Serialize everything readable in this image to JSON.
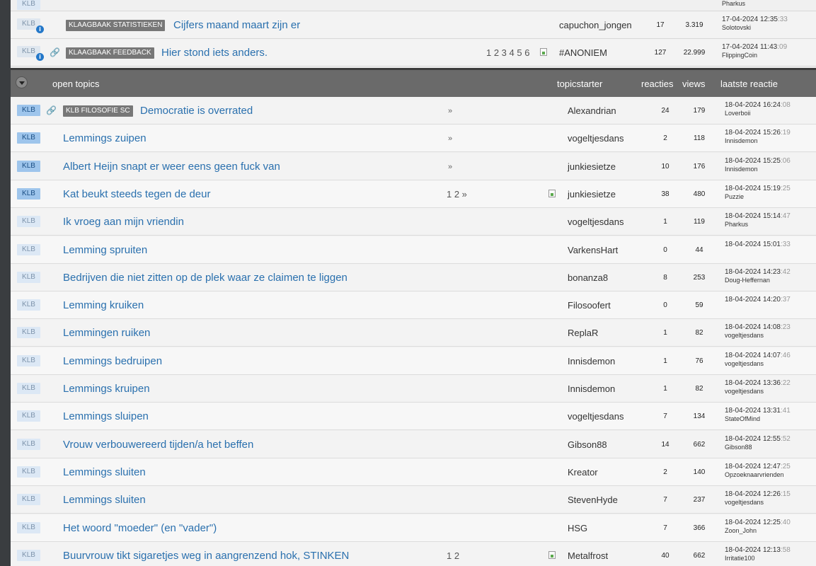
{
  "partial_row": {
    "user": "Pharkus"
  },
  "pinned": [
    {
      "badge": "KLB",
      "tag": "KLAAGBAAK STATISTIEKEN",
      "title": "Cijfers maand maart zijn er",
      "pages": "",
      "starter": "capuchon_jongen",
      "reacties": "17",
      "views": "3.319",
      "date": "17-04-2024",
      "time": "12:35",
      "sec": ":33",
      "last_user": "Solotovski"
    },
    {
      "badge": "KLB",
      "tag": "KLAAGBAAK FEEDBACK",
      "title": "Hier stond iets anders.",
      "pages": "1 2 3 4 5 6",
      "starter": "#ANONIEM",
      "reacties": "127",
      "views": "22.999",
      "date": "17-04-2024",
      "time": "11:43",
      "sec": ":09",
      "last_user": "FlippingCoin"
    }
  ],
  "header": {
    "open_topics": "open topics",
    "topicstarter": "topicstarter",
    "reacties": "reacties",
    "views": "views",
    "laatste_reactie": "laatste reactie"
  },
  "topics": [
    {
      "badge": "KLB",
      "tag": "KLB FILOSOFIE SC",
      "title": "Democratie is overrated",
      "pages": "",
      "arrow": "»",
      "starter": "Alexandrian",
      "reacties": "24",
      "views": "179",
      "date": "18-04-2024",
      "time": "16:24",
      "sec": ":08",
      "last_user": "Loverboii"
    },
    {
      "badge": "KLB",
      "title": "Lemmings zuipen",
      "pages": "",
      "arrow": "»",
      "starter": "vogeltjesdans",
      "reacties": "2",
      "views": "118",
      "date": "18-04-2024",
      "time": "15:26",
      "sec": ":19",
      "last_user": "Innisdemon"
    },
    {
      "badge": "KLB",
      "title": "Albert Heijn snapt er weer eens geen fuck van",
      "pages": "",
      "arrow": "»",
      "starter": "junkiesietze",
      "reacties": "10",
      "views": "176",
      "date": "18-04-2024",
      "time": "15:25",
      "sec": ":06",
      "last_user": "Innisdemon"
    },
    {
      "badge": "KLB",
      "title": "Kat beukt steeds tegen de deur",
      "pages": "1 2 »",
      "arrow": "",
      "starter": "junkiesietze",
      "reacties": "38",
      "views": "480",
      "date": "18-04-2024",
      "time": "15:19",
      "sec": ":25",
      "last_user": "Puzzie"
    },
    {
      "badge": "KLB",
      "title": "Ik vroeg aan mijn vriendin",
      "pages": "",
      "arrow": "",
      "starter": "vogeltjesdans",
      "reacties": "1",
      "views": "119",
      "date": "18-04-2024",
      "time": "15:14",
      "sec": ":47",
      "last_user": "Pharkus"
    },
    {
      "badge": "KLB",
      "title": "Lemming spruiten",
      "pages": "",
      "arrow": "",
      "starter": "VarkensHart",
      "reacties": "0",
      "views": "44",
      "date": "18-04-2024",
      "time": "15:01",
      "sec": ":33",
      "last_user": ""
    },
    {
      "badge": "KLB",
      "title": "Bedrijven die niet zitten op de plek waar ze claimen te liggen",
      "pages": "",
      "arrow": "",
      "starter": "bonanza8",
      "reacties": "8",
      "views": "253",
      "date": "18-04-2024",
      "time": "14:23",
      "sec": ":42",
      "last_user": "Doug-Heffernan"
    },
    {
      "badge": "KLB",
      "title": "Lemming kruiken",
      "pages": "",
      "arrow": "",
      "starter": "Filosoofert",
      "reacties": "0",
      "views": "59",
      "date": "18-04-2024",
      "time": "14:20",
      "sec": ":37",
      "last_user": ""
    },
    {
      "badge": "KLB",
      "title": "Lemmingen ruiken",
      "pages": "",
      "arrow": "",
      "starter": "ReplaR",
      "reacties": "1",
      "views": "82",
      "date": "18-04-2024",
      "time": "14:08",
      "sec": ":23",
      "last_user": "vogeltjesdans"
    },
    {
      "badge": "KLB",
      "title": "Lemmings bedruipen",
      "pages": "",
      "arrow": "",
      "starter": "Innisdemon",
      "reacties": "1",
      "views": "76",
      "date": "18-04-2024",
      "time": "14:07",
      "sec": ":46",
      "last_user": "vogeltjesdans"
    },
    {
      "badge": "KLB",
      "title": "Lemmings kruipen",
      "pages": "",
      "arrow": "",
      "starter": "Innisdemon",
      "reacties": "1",
      "views": "82",
      "date": "18-04-2024",
      "time": "13:36",
      "sec": ":22",
      "last_user": "vogeltjesdans"
    },
    {
      "badge": "KLB",
      "title": "Lemmings sluipen",
      "pages": "",
      "arrow": "",
      "starter": "vogeltjesdans",
      "reacties": "7",
      "views": "134",
      "date": "18-04-2024",
      "time": "13:31",
      "sec": ":41",
      "last_user": "StateOfMind"
    },
    {
      "badge": "KLB",
      "title": "Vrouw verbouwereerd tijden/a het beffen",
      "pages": "",
      "arrow": "",
      "starter": "Gibson88",
      "reacties": "14",
      "views": "662",
      "date": "18-04-2024",
      "time": "12:55",
      "sec": ":52",
      "last_user": "Gibson88"
    },
    {
      "badge": "KLB",
      "title": "Lemmings sluiten",
      "pages": "",
      "arrow": "",
      "starter": "Kreator",
      "reacties": "2",
      "views": "140",
      "date": "18-04-2024",
      "time": "12:47",
      "sec": ":25",
      "last_user": "Opzoeknaarvrienden"
    },
    {
      "badge": "KLB",
      "title": "Lemmings sluiten",
      "pages": "",
      "arrow": "",
      "starter": "StevenHyde",
      "reacties": "7",
      "views": "237",
      "date": "18-04-2024",
      "time": "12:26",
      "sec": ":15",
      "last_user": "vogeltjesdans"
    },
    {
      "badge": "KLB",
      "title": "Het woord \"moeder\" (en \"vader\")",
      "pages": "",
      "arrow": "",
      "starter": "HSG",
      "reacties": "7",
      "views": "366",
      "date": "18-04-2024",
      "time": "12:25",
      "sec": ":40",
      "last_user": "Zoon_John"
    },
    {
      "badge": "KLB",
      "title": "Buurvrouw tikt sigaretjes weg in aangrenzend hok, STINKEN",
      "pages": "1 2",
      "arrow": "",
      "starter": "Metalfrost",
      "reacties": "40",
      "views": "662",
      "date": "18-04-2024",
      "time": "12:13",
      "sec": ":58",
      "last_user": "Irritatie100"
    }
  ]
}
